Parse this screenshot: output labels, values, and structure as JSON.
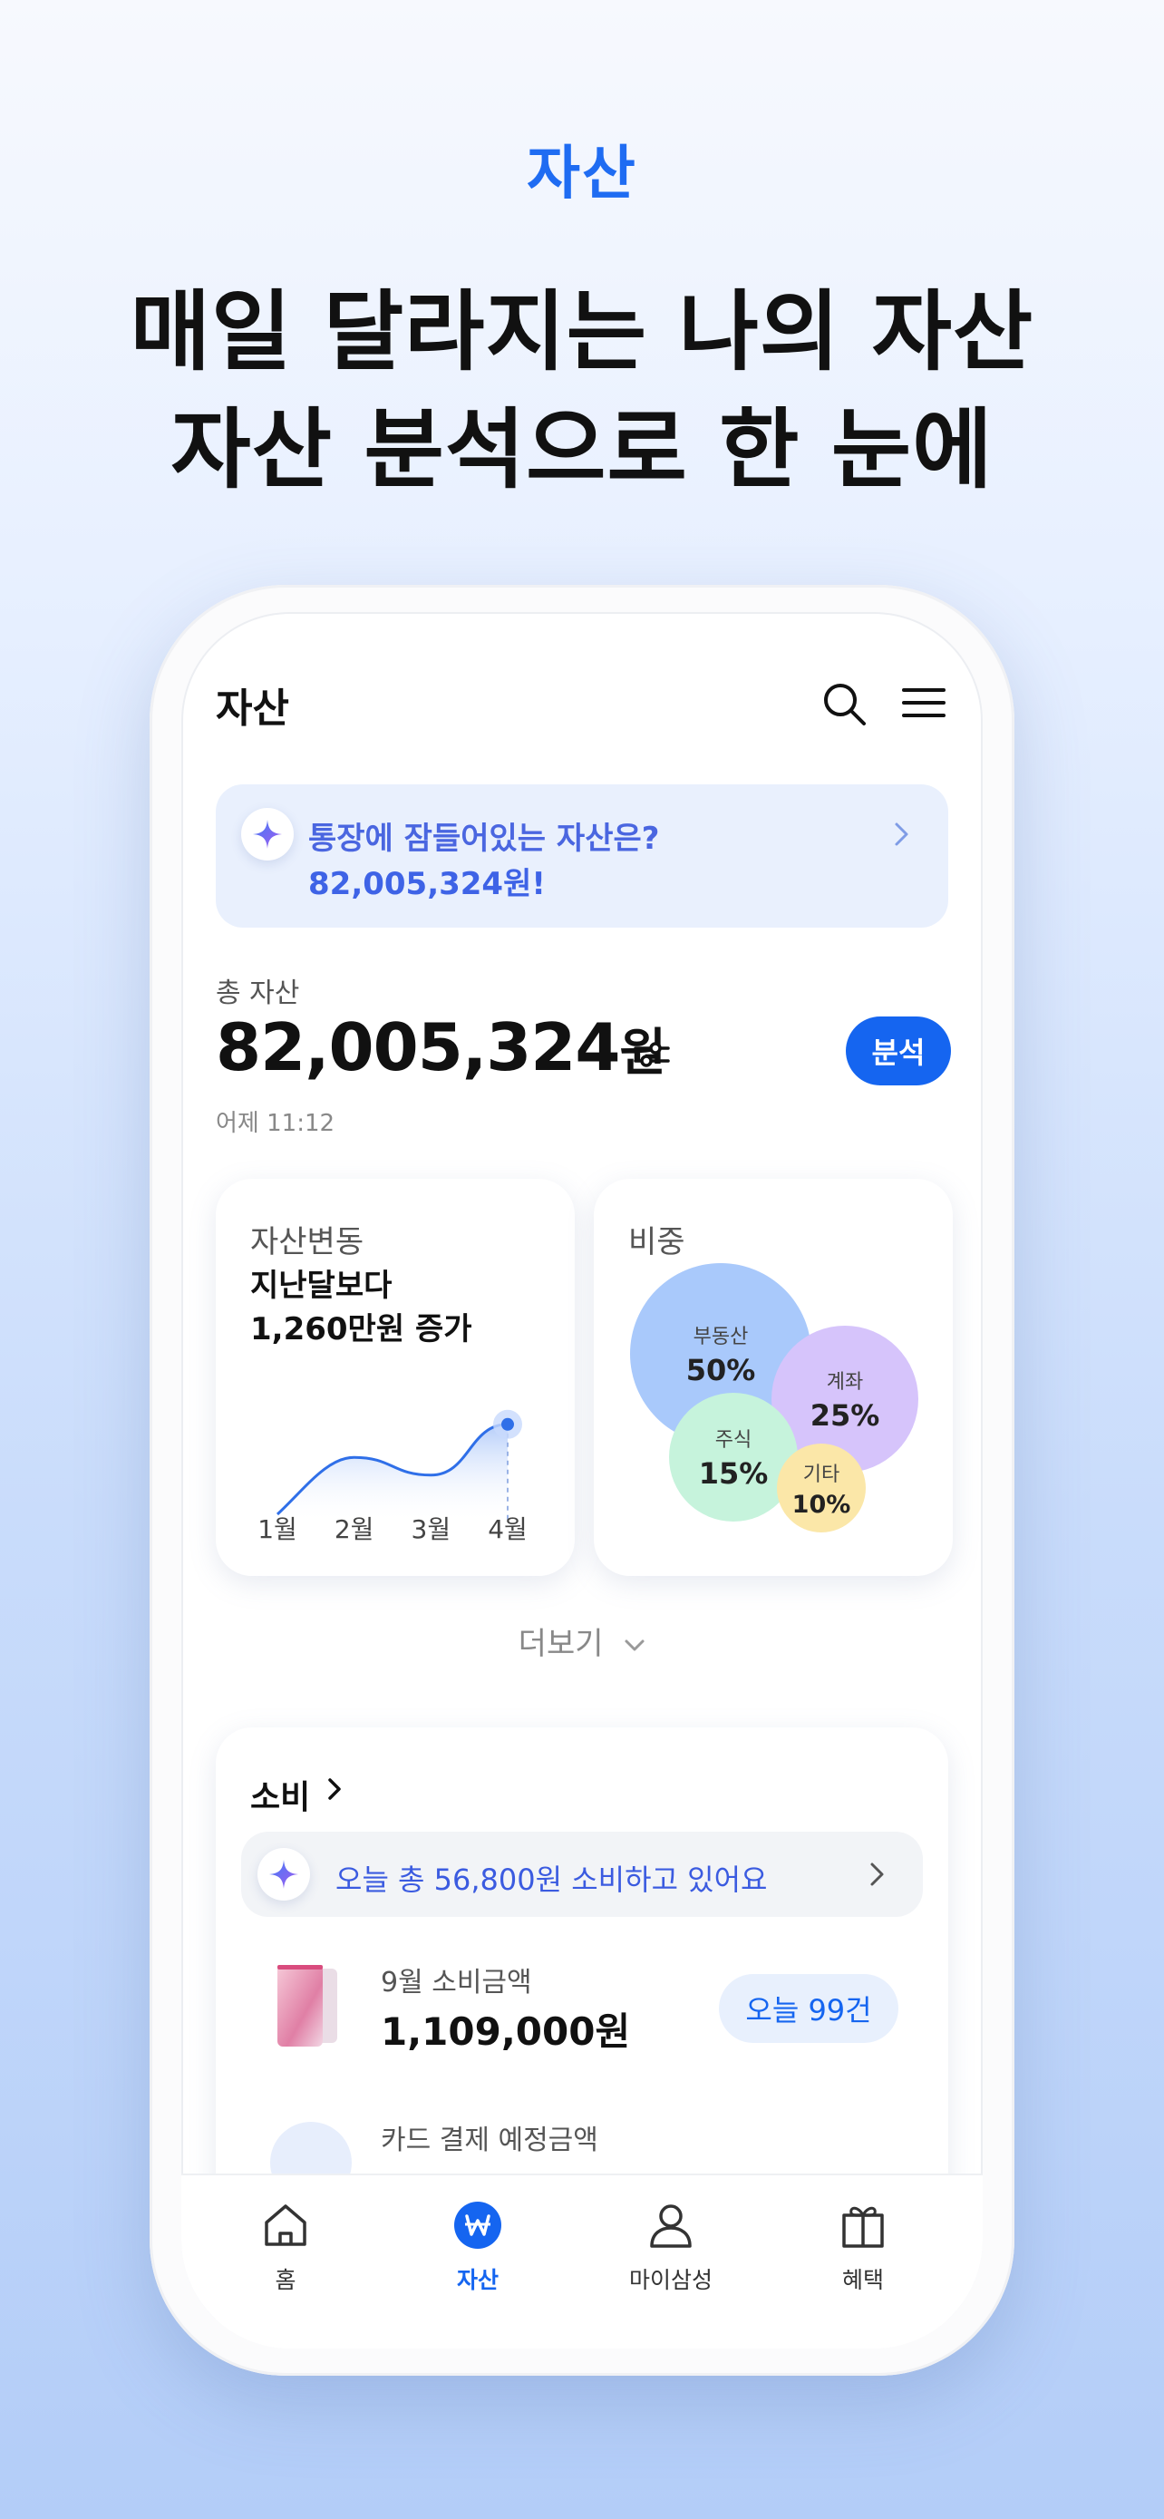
{
  "promo": {
    "tag": "자산",
    "headline_1": "매일 달라지는 나의 자산",
    "headline_2": "자산 분석으로 한 눈에"
  },
  "header": {
    "title": "자산",
    "search_icon": "search-icon",
    "menu_icon": "hamburger-menu-icon"
  },
  "ai_banner": {
    "line1": "통장에 잠들어있는 자산은?",
    "line2": "82,005,324원!"
  },
  "total": {
    "label": "총 자산",
    "amount": "82,005,324",
    "unit": "원",
    "analyze_button": "분석",
    "updated": "어제 11:12"
  },
  "change_card": {
    "title": "자산변동",
    "line1": "지난달보다",
    "line2": "1,260만원 증가"
  },
  "chart_data": {
    "type": "area",
    "title": "자산변동",
    "x": [
      "1월",
      "2월",
      "3월",
      "4월"
    ],
    "values": [
      20,
      52,
      38,
      78
    ],
    "ylim": [
      0,
      100
    ],
    "grid": false,
    "legend": "none",
    "color": "#2f6fe8"
  },
  "weight_card": {
    "title": "비중",
    "items": [
      {
        "name": "부동산",
        "pct": "50%",
        "value": 50,
        "color": "#a9c9fb"
      },
      {
        "name": "계좌",
        "pct": "25%",
        "value": 25,
        "color": "#d6c4fb"
      },
      {
        "name": "주식",
        "pct": "15%",
        "value": 15,
        "color": "#c6f3dc"
      },
      {
        "name": "기타",
        "pct": "10%",
        "value": 10,
        "color": "#fbe7a8"
      }
    ]
  },
  "more": {
    "label": "더보기"
  },
  "spend": {
    "title": "소비",
    "banner": "오늘 총 56,800원 소비하고 있어요",
    "month_label": "9월 소비금액",
    "month_amount": "1,109,000원",
    "today_pill": "오늘 99건",
    "card_pay_label": "카드 결제 예정금액"
  },
  "tabbar": {
    "items": [
      {
        "label": "홈",
        "icon": "home-icon"
      },
      {
        "label": "자산",
        "icon": "won-icon"
      },
      {
        "label": "마이삼성",
        "icon": "person-icon"
      },
      {
        "label": "혜택",
        "icon": "gift-icon"
      }
    ]
  },
  "colors": {
    "accent": "#1565f0",
    "banner_bg": "#e9f0fd"
  }
}
